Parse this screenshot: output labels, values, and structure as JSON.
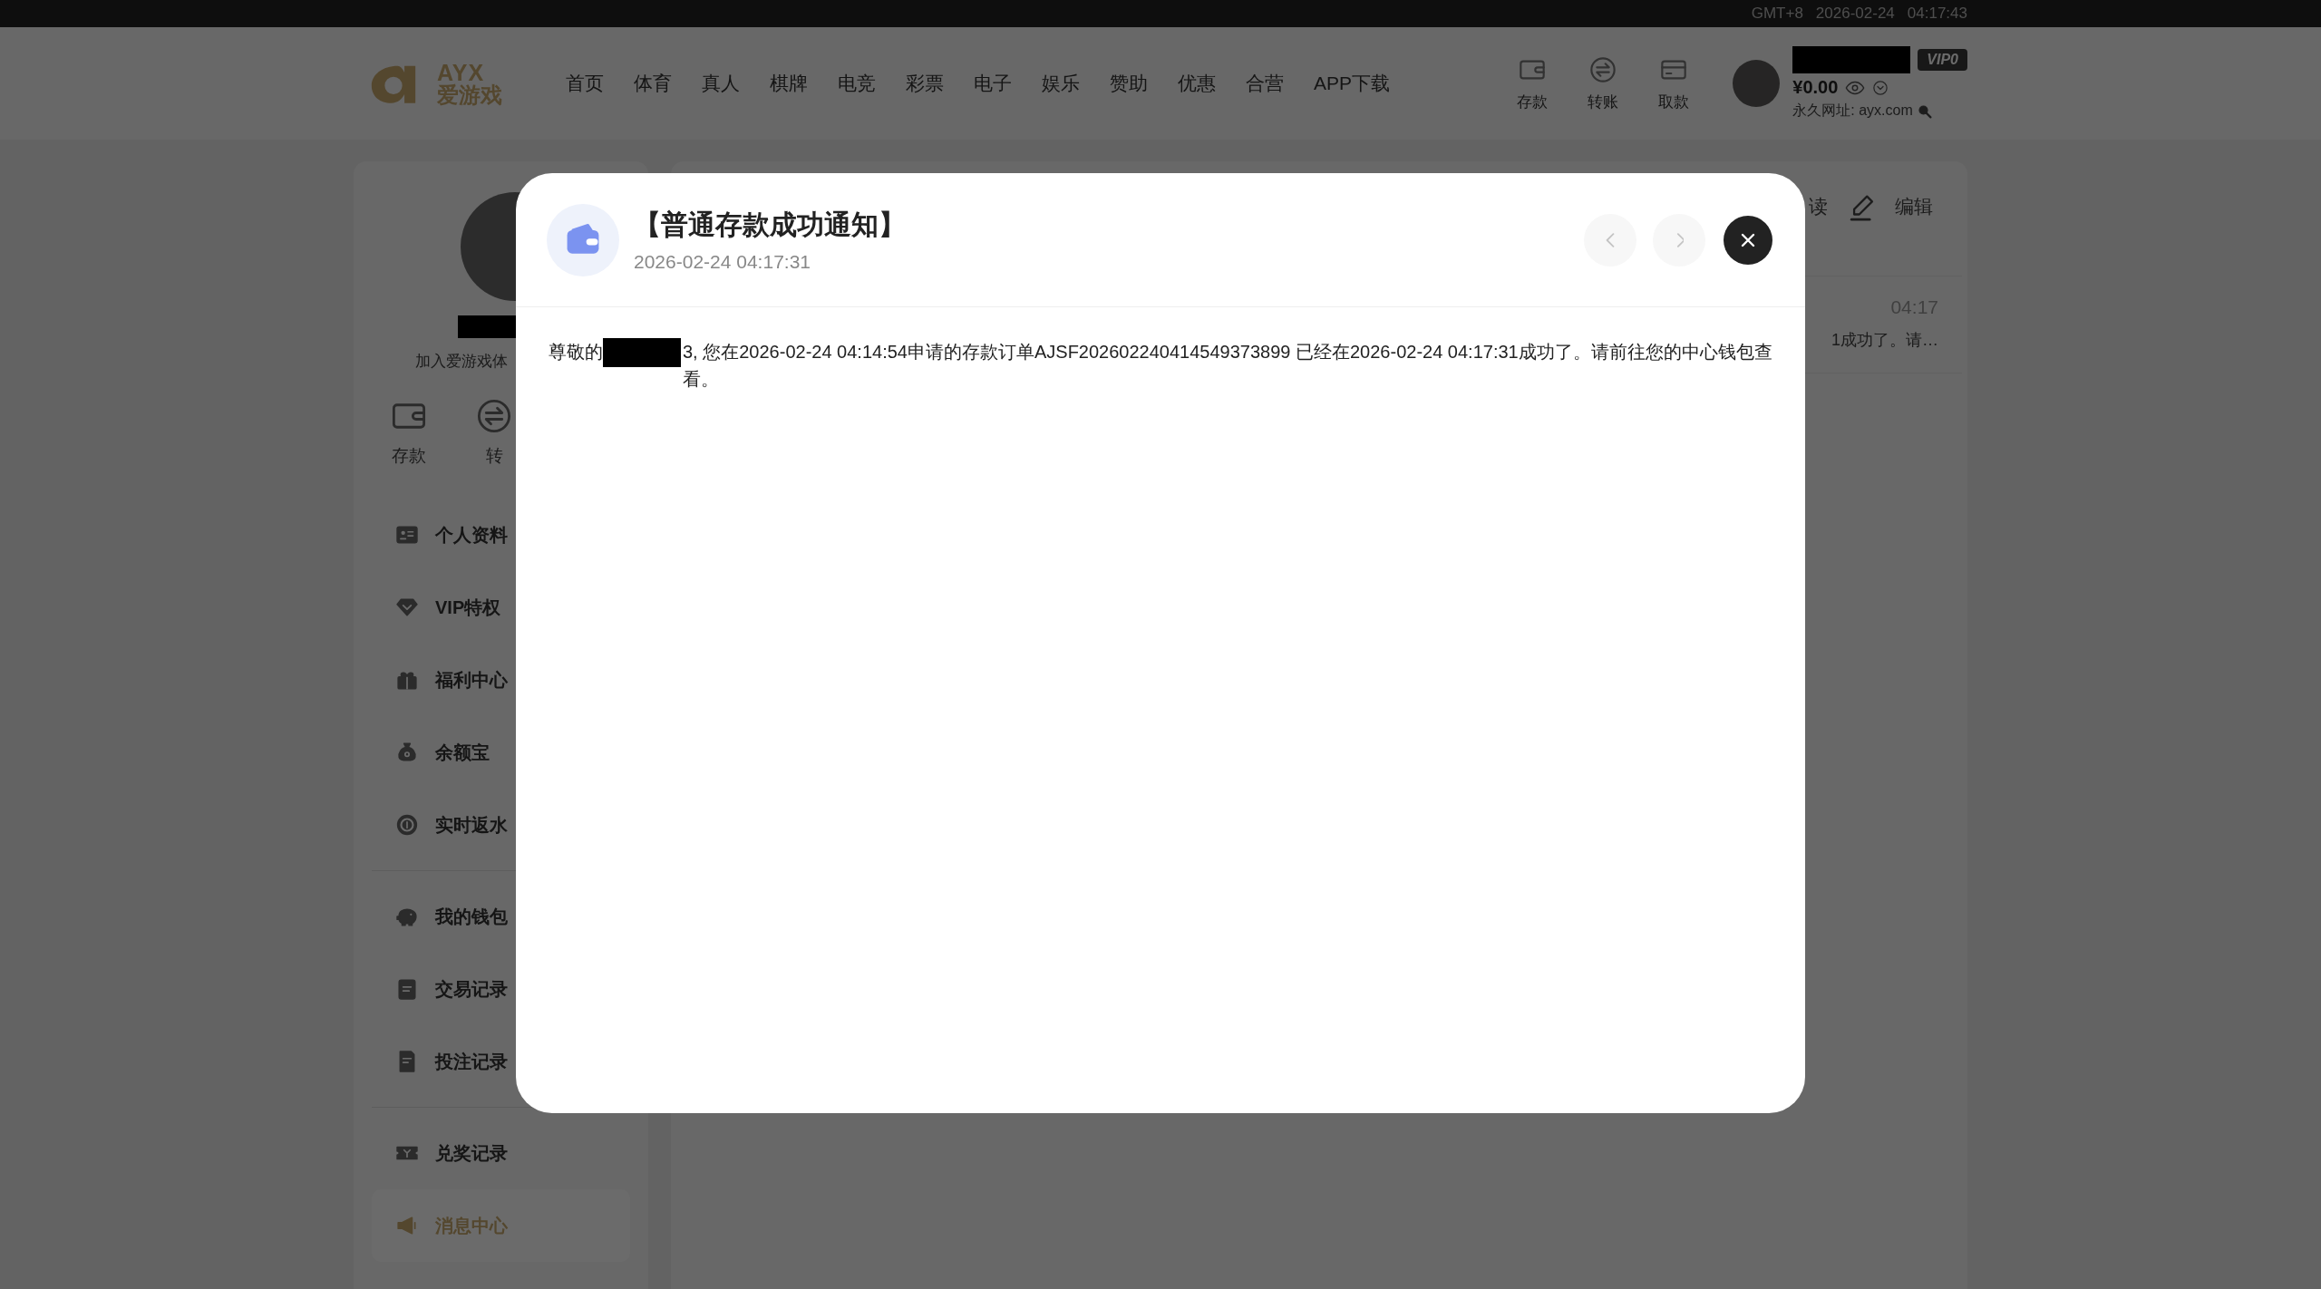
{
  "top_bar": {
    "timezone": "GMT+8",
    "date": "2026-02-24",
    "time": "04:17:43"
  },
  "header": {
    "logo": {
      "latin": "AYX",
      "chinese": "爱游戏"
    },
    "nav": [
      "首页",
      "体育",
      "真人",
      "棋牌",
      "电竞",
      "彩票",
      "电子",
      "娱乐",
      "赞助",
      "优惠",
      "合营",
      "APP下载"
    ],
    "actions": [
      {
        "kind": "deposit",
        "label": "存款"
      },
      {
        "kind": "transfer",
        "label": "转账"
      },
      {
        "kind": "withdraw",
        "label": "取款"
      }
    ],
    "user": {
      "vip": "VIP0",
      "balance": "¥0.00",
      "permanent_url": "永久网址: ayx.com"
    }
  },
  "sidebar": {
    "tagline": "加入爱游戏体",
    "quick_actions": [
      {
        "kind": "deposit",
        "label": "存款"
      },
      {
        "kind": "transfer",
        "label": "转"
      }
    ],
    "menu_groups": [
      {
        "items": [
          {
            "kind": "profile",
            "label": "个人资料",
            "selected": false
          },
          {
            "kind": "vip",
            "label": "VIP特权",
            "selected": false
          },
          {
            "kind": "gift",
            "label": "福利中心",
            "selected": false
          },
          {
            "kind": "moneybag",
            "label": "余额宝",
            "selected": false
          },
          {
            "kind": "rebate",
            "label": "实时返水",
            "selected": false
          }
        ]
      },
      {
        "items": [
          {
            "kind": "wallet",
            "label": "我的钱包",
            "selected": false
          },
          {
            "kind": "records",
            "label": "交易记录",
            "selected": false
          },
          {
            "kind": "bets",
            "label": "投注记录",
            "selected": false
          }
        ]
      },
      {
        "items": [
          {
            "kind": "ticket",
            "label": "兑奖记录",
            "selected": false
          },
          {
            "kind": "message",
            "label": "消息中心",
            "selected": true
          }
        ]
      }
    ]
  },
  "content": {
    "toolbar": [
      {
        "kind": "read",
        "label": "读"
      },
      {
        "kind": "edit",
        "label": "编辑"
      }
    ],
    "message": {
      "time": "04:17",
      "preview": "1成功了。请…"
    }
  },
  "modal": {
    "title": "【普通存款成功通知】",
    "date": "2026-02-24 04:17:31",
    "greeting": "尊敬的",
    "body": "3, 您在2026-02-24 04:14:54申请的存款订单AJSF202602240414549373899 已经在2026-02-24 04:17:31成功了。请前往您的中心钱包查看。",
    "prev": {
      "disabled": true
    },
    "next": {
      "disabled": true
    }
  }
}
